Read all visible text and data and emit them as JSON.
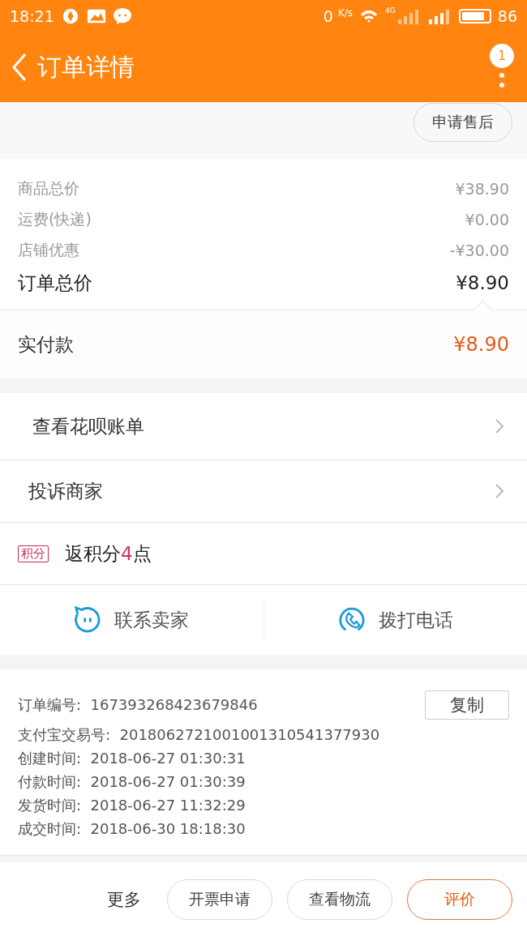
{
  "status_bar": {
    "time": "18:21",
    "speed_value": "0",
    "speed_unit": "K/s",
    "network": "4G",
    "battery": "86"
  },
  "header": {
    "title": "订单详情",
    "badge": "1"
  },
  "after_sale_button": "申请售后",
  "prices": [
    {
      "label": "商品总价",
      "value": "¥38.90",
      "kind": "minor"
    },
    {
      "label": "运费(快递)",
      "value": "¥0.00",
      "kind": "minor"
    },
    {
      "label": "店铺优惠",
      "value": "-¥30.00",
      "kind": "minor"
    },
    {
      "label": "订单总价",
      "value": "¥8.90",
      "kind": "total"
    }
  ],
  "paid": {
    "label": "实付款",
    "value": "¥8.90"
  },
  "links": [
    {
      "label": "查看花呗账单"
    },
    {
      "label": "投诉商家"
    }
  ],
  "points": {
    "tag": "积分",
    "text_before": "返积分",
    "points": "4",
    "text_after": "点"
  },
  "contacts": [
    {
      "label": "联系卖家",
      "kind": "chat"
    },
    {
      "label": "拨打电话",
      "kind": "phone"
    }
  ],
  "order_info": {
    "copy_button": "复制",
    "rows": [
      {
        "label": "订单编号:",
        "value": "167393268423679846"
      },
      {
        "label": "支付宝交易号:",
        "value": "2018062721001001310541377930"
      },
      {
        "label": "创建时间:",
        "value": "2018-06-27 01:30:31"
      },
      {
        "label": "付款时间:",
        "value": "2018-06-27 01:30:39"
      },
      {
        "label": "发货时间:",
        "value": "2018-06-27 11:32:29"
      },
      {
        "label": "成交时间:",
        "value": "2018-06-30 18:18:30"
      }
    ]
  },
  "bottom_bar": {
    "more": "更多",
    "buttons": [
      {
        "label": "开票申请",
        "kind": "plain"
      },
      {
        "label": "查看物流",
        "kind": "plain"
      },
      {
        "label": "评价",
        "kind": "primary"
      }
    ]
  }
}
